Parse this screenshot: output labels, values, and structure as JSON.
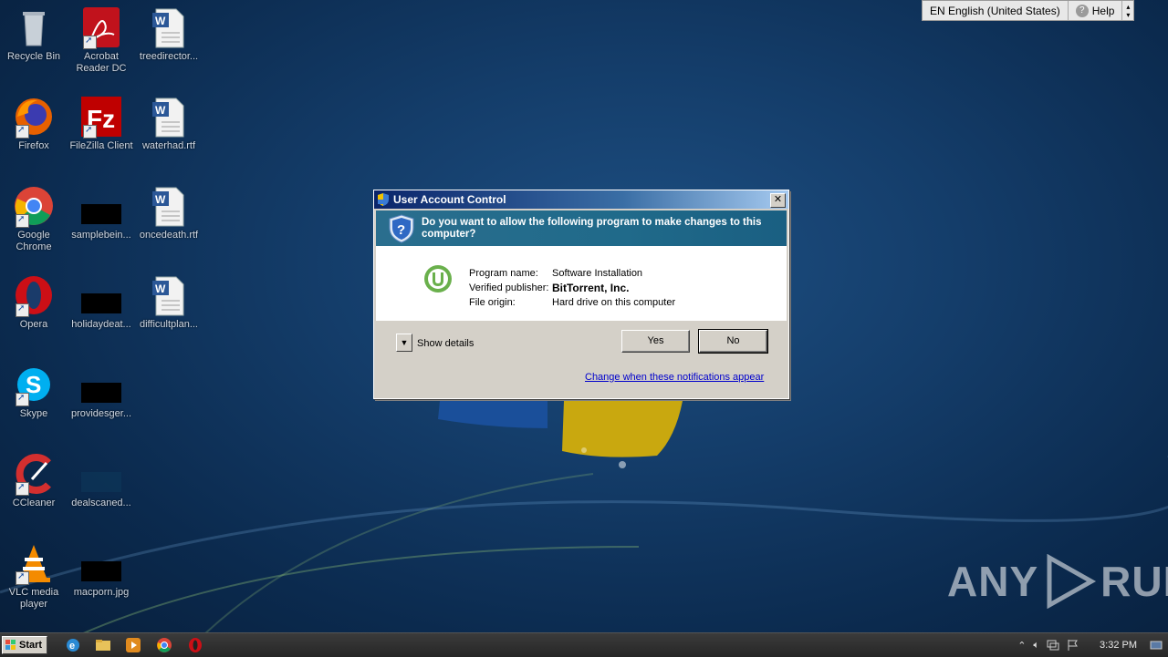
{
  "desktop": {
    "icons": [
      {
        "name": "recycle-bin",
        "label": "Recycle Bin"
      },
      {
        "name": "acrobat-reader",
        "label": "Acrobat\nReader DC"
      },
      {
        "name": "doc-treedirector",
        "label": "treedirector..."
      },
      {
        "name": "firefox",
        "label": "Firefox"
      },
      {
        "name": "filezilla",
        "label": "FileZilla Client"
      },
      {
        "name": "doc-waterhad",
        "label": "waterhad.rtf"
      },
      {
        "name": "google-chrome",
        "label": "Google\nChrome"
      },
      {
        "name": "file-samplebein",
        "label": "samplebein..."
      },
      {
        "name": "doc-oncedeath",
        "label": "oncedeath.rtf"
      },
      {
        "name": "opera",
        "label": "Opera"
      },
      {
        "name": "file-holidaydeat",
        "label": "holidaydeat..."
      },
      {
        "name": "doc-difficultplan",
        "label": "difficultplan..."
      },
      {
        "name": "skype",
        "label": "Skype"
      },
      {
        "name": "file-providesger",
        "label": "providesger..."
      },
      {
        "name": "ccleaner",
        "label": "CCleaner"
      },
      {
        "name": "file-dealscaned",
        "label": "dealscaned..."
      },
      {
        "name": "vlc",
        "label": "VLC media\nplayer"
      },
      {
        "name": "file-macporn",
        "label": "macporn.jpg"
      }
    ]
  },
  "langbar": {
    "language": "EN English (United States)",
    "help": "Help"
  },
  "dialog": {
    "title": "User Account Control",
    "question": "Do you want to allow the following program to make changes to this computer?",
    "program_name_label": "Program name:",
    "program_name": "Software Installation",
    "publisher_label": "Verified publisher:",
    "publisher": "BitTorrent, Inc.",
    "origin_label": "File origin:",
    "origin": "Hard drive on this computer",
    "show_details": "Show details",
    "yes": "Yes",
    "no": "No",
    "link": "Change when these notifications appear"
  },
  "watermark": {
    "left": "ANY",
    "right": "RUN"
  },
  "taskbar": {
    "start": "Start",
    "clock": "3:32 PM"
  }
}
